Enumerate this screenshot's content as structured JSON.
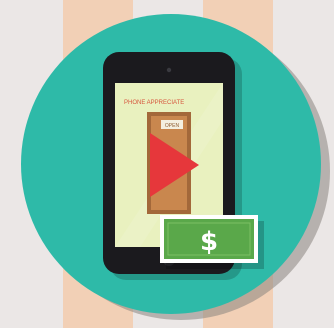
{
  "scene": {
    "colors": {
      "stripe_light": "#ebe7e6",
      "stripe_peach": "#f2d0b6",
      "circle": "#2ebaa8",
      "circle_shadow": "#8a857f",
      "phone_body": "#1b1a1e",
      "phone_screen": "#e9f1bf",
      "screen_heading": "#d6573e",
      "door": "#c9874e",
      "door_frame": "#a3683a",
      "play_button": "#e6373b",
      "bill_fill": "#5aa84a",
      "bill_border": "#ffffff",
      "bill_text": "#ffffff"
    },
    "screen_heading_text": "PHONE APPRECIATE",
    "sign_text": "OPEN",
    "bill_symbol": "$",
    "icons": [
      "smartphone-icon",
      "play-icon",
      "dollar-bill-icon"
    ]
  }
}
